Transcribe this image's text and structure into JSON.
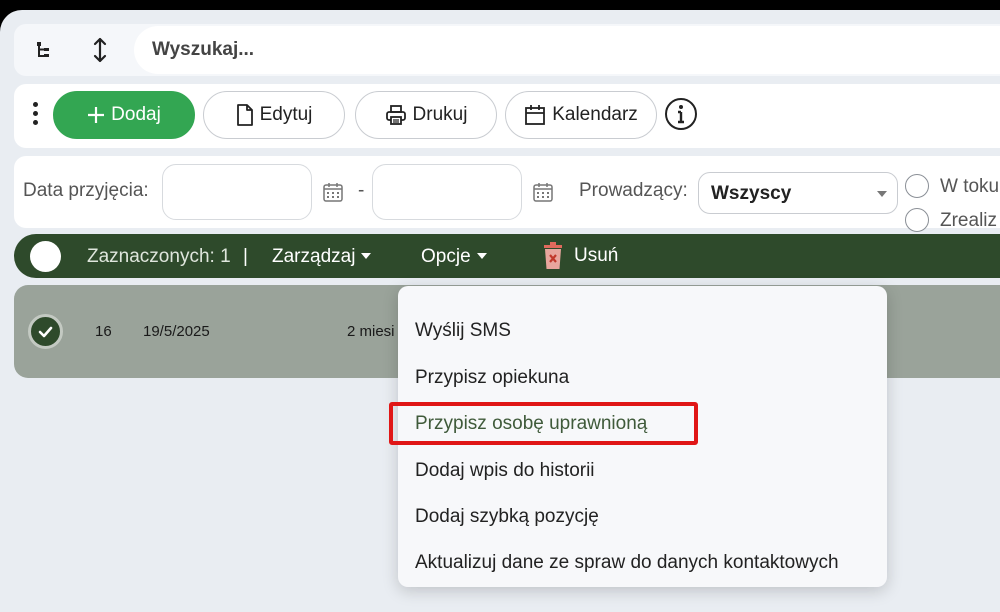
{
  "search": {
    "placeholder": "Wyszukaj..."
  },
  "toolbar": {
    "add_label": "Dodaj",
    "edit_label": "Edytuj",
    "print_label": "Drukuj",
    "calendar_label": "Kalendarz"
  },
  "filters": {
    "date_label": "Data przyjęcia:",
    "date_from": "",
    "date_to": "",
    "date_separator": "-",
    "owner_label": "Prowadzący:",
    "owner_value": "Wszyscy",
    "status_options": [
      "W toku",
      "Zrealiz"
    ]
  },
  "selection_bar": {
    "selected_text": "Zaznaczonych: 1",
    "separator": "|",
    "manage_label": "Zarządzaj",
    "options_label": "Opcje",
    "delete_label": "Usuń"
  },
  "rows": [
    {
      "id": "16",
      "date": "19/5/2025",
      "age": "2 miesi",
      "checked": true
    }
  ],
  "options_menu": {
    "items": [
      "Wyślij SMS",
      "Przypisz opiekuna",
      "Przypisz osobę uprawnioną",
      "Dodaj wpis do historii",
      "Dodaj szybką pozycję",
      "Aktualizuj dane ze spraw do danych kontaktowych"
    ],
    "highlighted_index": 2
  },
  "colors": {
    "accent_green": "#33a652",
    "bar_dark_green": "#2e4a2b",
    "row_selected": "#9aa39a",
    "delete_icon": "#e06a5c",
    "highlight_border": "#e01616"
  },
  "icons": [
    "tree-icon",
    "sort-vertical-icon",
    "plus-icon",
    "document-icon",
    "printer-icon",
    "calendar-icon",
    "info-icon",
    "trash-icon",
    "check-icon"
  ]
}
